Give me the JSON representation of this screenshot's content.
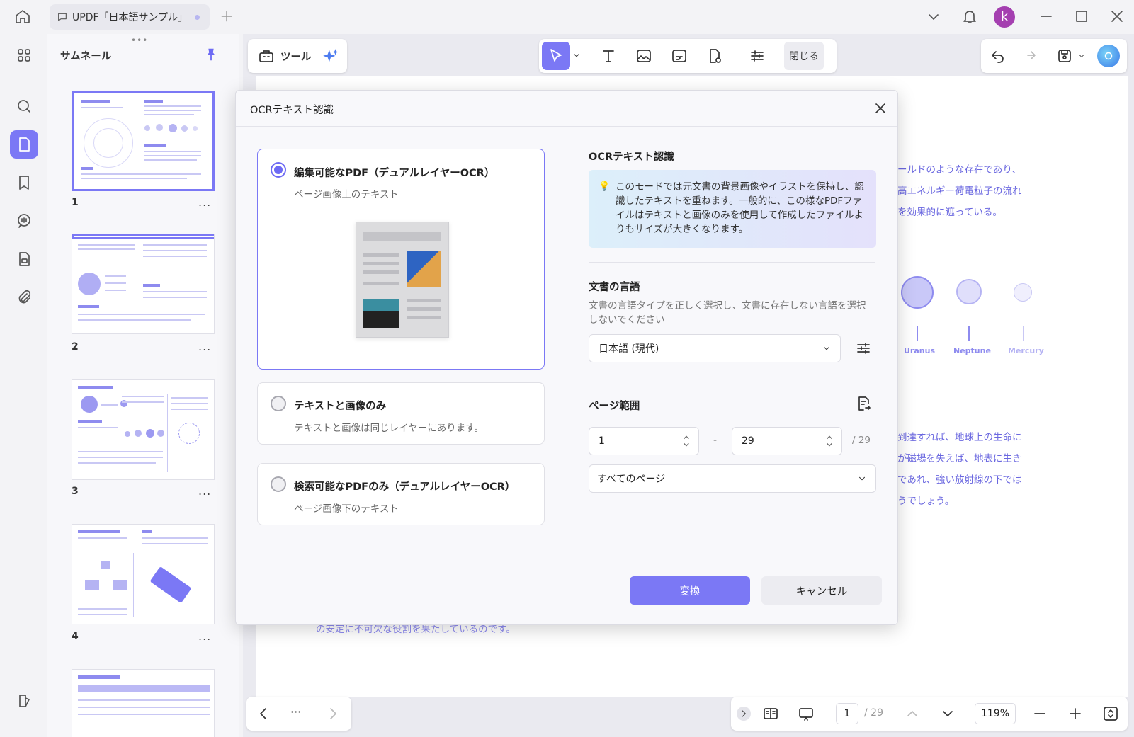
{
  "app": {
    "tab_title": "UPDF「日本語サンプル」",
    "avatar_letter": "k",
    "accent_color": "#7b78f5"
  },
  "thumbnails": {
    "panel_title": "サムネール",
    "more": "...",
    "pages": [
      "1",
      "2",
      "3",
      "4"
    ]
  },
  "toolbar": {
    "tools_label": "ツール",
    "close_label": "閉じる"
  },
  "page_content": {
    "lines_top": [
      "ールドのような存在であり、",
      "高エネルギー荷電粒子の流れ",
      "を効果的に遮っている。"
    ],
    "planets": [
      "Uranus",
      "Neptune",
      "Mercury"
    ],
    "lines_mid": [
      "到達すれば、地球上の生命に",
      "が磁場を失えば、地表に生き",
      "であれ、強い放射線の下では",
      "うでしょう。"
    ],
    "line_bottom": "の安定に不可欠な役割を果たしているのです。"
  },
  "dialog": {
    "title": "OCRテキスト認識",
    "options": [
      {
        "title": "編集可能なPDF（デュアルレイヤーOCR）",
        "desc": "ページ画像上のテキスト",
        "selected": true
      },
      {
        "title": "テキストと画像のみ",
        "desc": "テキストと画像は同じレイヤーにあります。",
        "selected": false
      },
      {
        "title": "検索可能なPDFのみ（デュアルレイヤーOCR）",
        "desc": "ページ画像下のテキスト",
        "selected": false
      }
    ],
    "right": {
      "section_title": "OCRテキスト認識",
      "info_text": "このモードでは元文書の背景画像やイラストを保持し、認識したテキストを重ねます。一般的に、この様なPDFファイルはテキストと画像のみを使用して作成したファイルよりもサイズが大きくなります。",
      "lang_title": "文書の言語",
      "lang_desc": "文書の言語タイプを正しく選択し、文書に存在しない言語を選択しないでください",
      "lang_value": "日本語 (現代)",
      "range_title": "ページ範囲",
      "range_from": "1",
      "range_dash": "-",
      "range_to": "29",
      "range_total": "/ 29",
      "range_mode": "すべてのページ"
    },
    "convert_label": "変換",
    "cancel_label": "キャンセル"
  },
  "bottom": {
    "nav_more": "···",
    "page_current": "1",
    "page_total": "/ 29",
    "zoom": "119%"
  }
}
